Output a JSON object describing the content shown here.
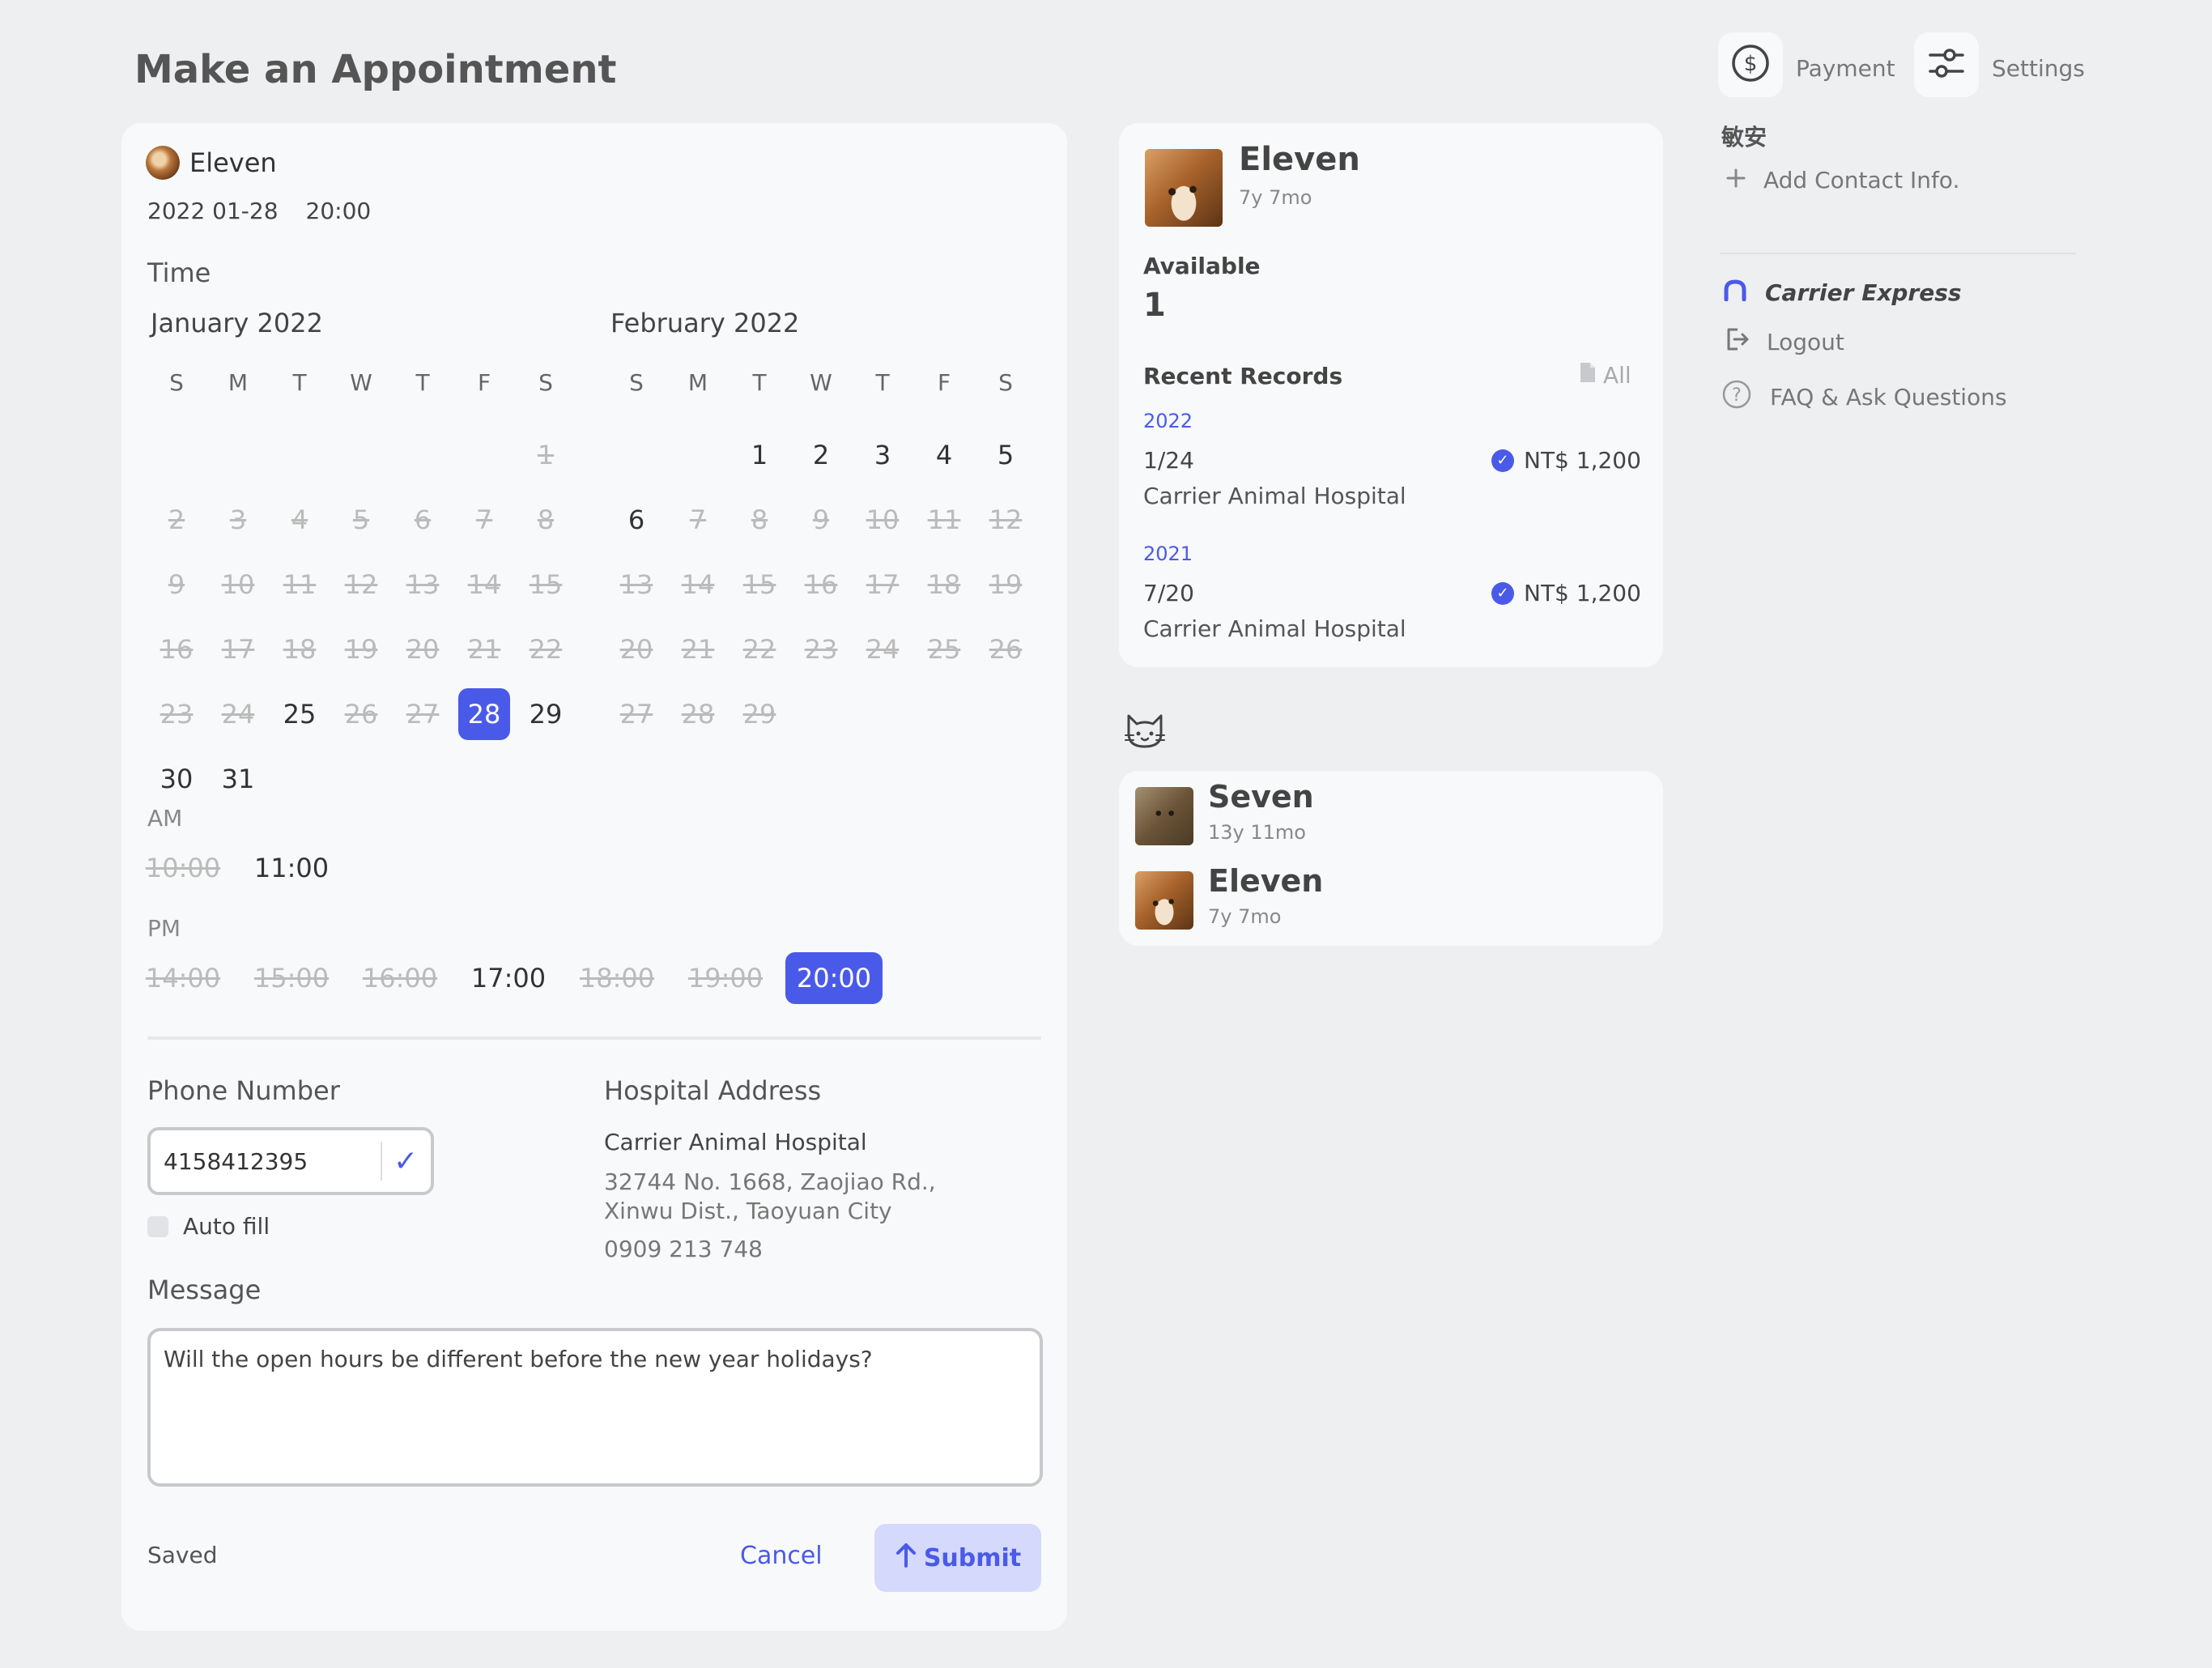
{
  "page_title": "Make an Appointment",
  "appointment": {
    "pet_name": "Eleven",
    "date": "2022 01-28",
    "time": "20:00"
  },
  "time_section_label": "Time",
  "calendar": {
    "weekdays": [
      "S",
      "M",
      "T",
      "W",
      "T",
      "F",
      "S"
    ],
    "months": [
      {
        "title": "January 2022",
        "offset": 6,
        "days": [
          {
            "d": "1",
            "s": "u"
          },
          {
            "d": "2",
            "s": "u"
          },
          {
            "d": "3",
            "s": "u"
          },
          {
            "d": "4",
            "s": "u"
          },
          {
            "d": "5",
            "s": "u"
          },
          {
            "d": "6",
            "s": "u"
          },
          {
            "d": "7",
            "s": "u"
          },
          {
            "d": "8",
            "s": "u"
          },
          {
            "d": "9",
            "s": "u"
          },
          {
            "d": "10",
            "s": "u"
          },
          {
            "d": "11",
            "s": "u"
          },
          {
            "d": "12",
            "s": "u"
          },
          {
            "d": "13",
            "s": "u"
          },
          {
            "d": "14",
            "s": "u"
          },
          {
            "d": "15",
            "s": "u"
          },
          {
            "d": "16",
            "s": "u"
          },
          {
            "d": "17",
            "s": "u"
          },
          {
            "d": "18",
            "s": "u"
          },
          {
            "d": "19",
            "s": "u"
          },
          {
            "d": "20",
            "s": "u"
          },
          {
            "d": "21",
            "s": "u"
          },
          {
            "d": "22",
            "s": "u"
          },
          {
            "d": "23",
            "s": "u"
          },
          {
            "d": "24",
            "s": "u"
          },
          {
            "d": "25",
            "s": "a"
          },
          {
            "d": "26",
            "s": "u"
          },
          {
            "d": "27",
            "s": "u"
          },
          {
            "d": "28",
            "s": "sel"
          },
          {
            "d": "29",
            "s": "a"
          },
          {
            "d": "30",
            "s": "a"
          },
          {
            "d": "31",
            "s": "a"
          }
        ]
      },
      {
        "title": "February 2022",
        "offset": 2,
        "days": [
          {
            "d": "1",
            "s": "a"
          },
          {
            "d": "2",
            "s": "a"
          },
          {
            "d": "3",
            "s": "a"
          },
          {
            "d": "4",
            "s": "a"
          },
          {
            "d": "5",
            "s": "a"
          },
          {
            "d": "6",
            "s": "a"
          },
          {
            "d": "7",
            "s": "u"
          },
          {
            "d": "8",
            "s": "u"
          },
          {
            "d": "9",
            "s": "u"
          },
          {
            "d": "10",
            "s": "u"
          },
          {
            "d": "11",
            "s": "u"
          },
          {
            "d": "12",
            "s": "u"
          },
          {
            "d": "13",
            "s": "u"
          },
          {
            "d": "14",
            "s": "u"
          },
          {
            "d": "15",
            "s": "u"
          },
          {
            "d": "16",
            "s": "u"
          },
          {
            "d": "17",
            "s": "u"
          },
          {
            "d": "18",
            "s": "u"
          },
          {
            "d": "19",
            "s": "u"
          },
          {
            "d": "20",
            "s": "u"
          },
          {
            "d": "21",
            "s": "u"
          },
          {
            "d": "22",
            "s": "u"
          },
          {
            "d": "23",
            "s": "u"
          },
          {
            "d": "24",
            "s": "u"
          },
          {
            "d": "25",
            "s": "u"
          },
          {
            "d": "26",
            "s": "u"
          },
          {
            "d": "27",
            "s": "u"
          },
          {
            "d": "28",
            "s": "u"
          },
          {
            "d": "29",
            "s": "u"
          }
        ]
      }
    ]
  },
  "slots": {
    "am_label": "AM",
    "am": [
      {
        "t": "10:00",
        "s": "u"
      },
      {
        "t": "11:00",
        "s": "a"
      }
    ],
    "pm_label": "PM",
    "pm": [
      {
        "t": "14:00",
        "s": "u"
      },
      {
        "t": "15:00",
        "s": "u"
      },
      {
        "t": "16:00",
        "s": "u"
      },
      {
        "t": "17:00",
        "s": "a"
      },
      {
        "t": "18:00",
        "s": "u"
      },
      {
        "t": "19:00",
        "s": "u"
      },
      {
        "t": "20:00",
        "s": "sel"
      }
    ]
  },
  "phone": {
    "label": "Phone Number",
    "value": "4158412395",
    "autofill_label": "Auto fill"
  },
  "hospital": {
    "label": "Hospital Address",
    "name": "Carrier Animal Hospital",
    "address": "32744 No. 1668, Zaojiao Rd., Xinwu Dist., Taoyuan City",
    "phone": "0909 213 748"
  },
  "message": {
    "label": "Message",
    "value": "Will the open hours be different before the new year holidays?"
  },
  "footer": {
    "status": "Saved",
    "cancel_label": "Cancel",
    "submit_label": "Submit"
  },
  "profile": {
    "name": "Eleven",
    "age": "7y 7mo",
    "available_label": "Available",
    "available_value": "1",
    "records_label": "Recent Records",
    "all_label": "All",
    "records": [
      {
        "year": "2022",
        "date": "1/24",
        "hospital": "Carrier Animal Hospital",
        "price": "NT$ 1,200"
      },
      {
        "year": "2021",
        "date": "7/20",
        "hospital": "Carrier Animal Hospital",
        "price": "NT$ 1,200"
      }
    ]
  },
  "pets": [
    {
      "name": "Seven",
      "age": "13y 11mo"
    },
    {
      "name": "Eleven",
      "age": "7y 7mo"
    }
  ],
  "header_actions": {
    "payment_label": "Payment",
    "settings_label": "Settings"
  },
  "sidebar": {
    "user_name": "敏安",
    "add_contact_label": "Add Contact Info.",
    "brand_label": "Carrier Express",
    "logout_label": "Logout",
    "faq_label": "FAQ & Ask Questions"
  },
  "colors": {
    "accent": "#4a5ae8",
    "background": "#eeeff1",
    "card": "#f8f9fb",
    "submit_bg": "#d5d9fb"
  }
}
